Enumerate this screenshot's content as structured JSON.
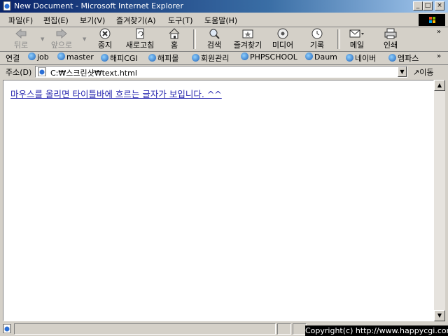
{
  "window": {
    "title": "New Document - Microsoft Internet Explorer",
    "minimize": "_",
    "maximize": "□",
    "close": "×"
  },
  "menu": [
    "파일(F)",
    "편집(E)",
    "보기(V)",
    "즐겨찾기(A)",
    "도구(T)",
    "도움말(H)"
  ],
  "toolbar": {
    "back": "뒤로",
    "forward": "앞으로",
    "stop": "중지",
    "refresh": "새로고침",
    "home": "홈",
    "search": "검색",
    "favorites": "즐겨찾기",
    "media": "미디어",
    "history": "기록",
    "mail": "메일",
    "print": "인쇄"
  },
  "links": {
    "label": "연결",
    "items": [
      "job",
      "master",
      "해피CGI",
      "해피몰",
      "회원관리",
      "PHPSCHOOL",
      "Daum",
      "네이버",
      "엠파스"
    ]
  },
  "address": {
    "label": "주소(D)",
    "value": "C:₩스크린샷₩text.html",
    "go": "이동"
  },
  "content": {
    "link_text": "마우스를 올리면 타이틀바에 흐르는 글자가 보입니다. ^^"
  },
  "status": {
    "copyright": "Copyright(c) http://www.happycgi.com"
  },
  "colors": {
    "titlebar_start": "#0a246a",
    "titlebar_end": "#a6caf0",
    "chrome": "#d4d0c8",
    "link": "#2a2ab0"
  }
}
